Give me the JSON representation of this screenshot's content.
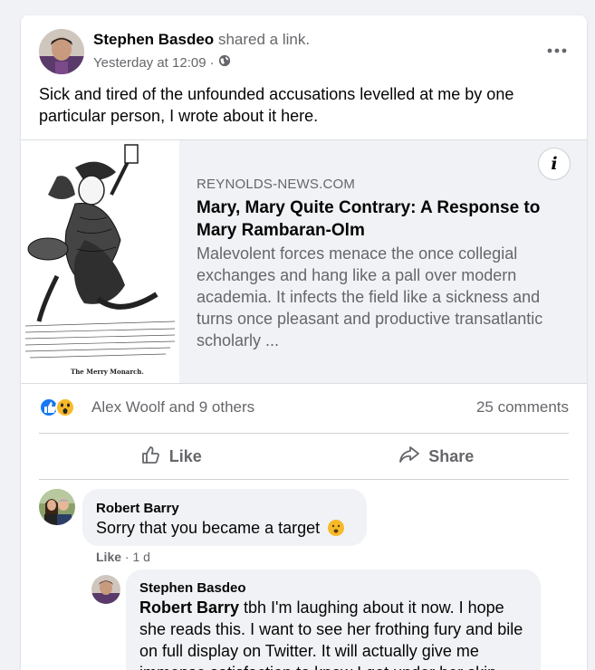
{
  "post": {
    "author": "Stephen Basdeo",
    "verb": "shared a link.",
    "time": "Yesterday at 12:09",
    "separator": "·",
    "text": "Sick and tired of the unfounded accusations levelled at me by one particular person, I wrote about it here."
  },
  "link": {
    "domain": "REYNOLDS-NEWS.COM",
    "title": "Mary, Mary Quite Contrary: A Response to Mary Rambaran-Olm",
    "description": "Malevolent forces menace the once collegial exchanges and hang like a pall over modern academia. It infects the field like a sickness and turns once pleasant and productive transatlantic scholarly ...",
    "image_caption": "The Merry Monarch.",
    "info_label": "i"
  },
  "reactions": {
    "names": "Alex Woolf and 9 others",
    "comments": "25 comments",
    "icons": [
      "like-icon",
      "wow-icon"
    ]
  },
  "actions": {
    "like": "Like",
    "share": "Share"
  },
  "comments": [
    {
      "author": "Robert Barry",
      "text": "Sorry that you became a target",
      "emoji": "😦",
      "like": "Like",
      "time": "· 1 d"
    },
    {
      "author": "Stephen Basdeo",
      "mention": "Robert Barry",
      "text": " tbh I'm laughing about it now. I hope she reads this. I want to see her frothing fury and bile on full display on Twitter. It will actually give me immense satisfaction to know I got under her skin."
    }
  ],
  "colors": {
    "like_blue": "#1877f2",
    "wow_yellow": "#f7b928",
    "text_secondary": "#65676b"
  }
}
